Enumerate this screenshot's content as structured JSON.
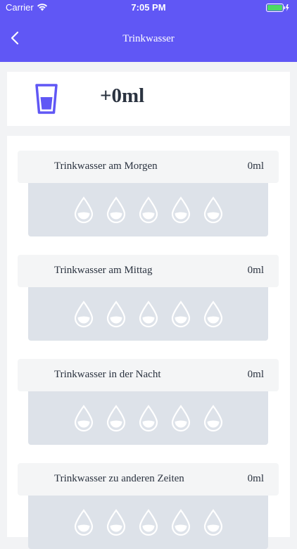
{
  "status_bar": {
    "carrier": "Carrier",
    "time": "7:05 PM",
    "wifi_icon": "wifi-icon",
    "battery_icon": "battery-icon"
  },
  "nav": {
    "title": "Trinkwasser",
    "back_icon": "chevron-left-icon"
  },
  "summary": {
    "glass_icon": "water-glass-icon",
    "total": "+0ml"
  },
  "sections": [
    {
      "label": "Trinkwasser am Morgen",
      "amount": "0ml"
    },
    {
      "label": "Trinkwasser am Mittag",
      "amount": "0ml"
    },
    {
      "label": "Trinkwasser in der Nacht",
      "amount": "0ml"
    },
    {
      "label": "Trinkwasser zu anderen Zeiten",
      "amount": "0ml"
    }
  ],
  "drop_icon": "water-drop-icon",
  "colors": {
    "accent": "#6057f5",
    "background": "#f2f3f5",
    "card": "#ffffff",
    "section_header": "#f4f5f6",
    "drops_panel": "#dde2e9",
    "text": "#2b3340"
  }
}
